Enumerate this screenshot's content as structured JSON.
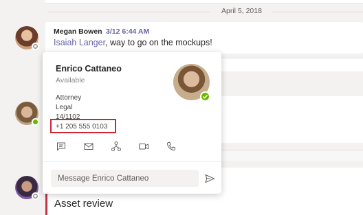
{
  "timeline": {
    "date": "April 5, 2018"
  },
  "message": {
    "author": "Megan Bowen",
    "time": "3/12 6:44 AM",
    "mention": "Isaiah Langer",
    "text": ", way to go on the mockups!"
  },
  "thread": {
    "title": "Asset review"
  },
  "profile_card": {
    "name": "Enrico Cattaneo",
    "status": "Available",
    "job_title": "Attorney",
    "department": "Legal",
    "office": "14/1102",
    "phone": "+1 205 555 0103",
    "presence_color": "#6bb700",
    "actions": [
      {
        "icon": "chat-icon"
      },
      {
        "icon": "mail-icon"
      },
      {
        "icon": "org-chart-icon"
      },
      {
        "icon": "video-call-icon"
      },
      {
        "icon": "phone-call-icon"
      }
    ],
    "message_placeholder": "Message Enrico Cattaneo",
    "highlight_color": "#d1242f"
  },
  "colors": {
    "accent": "#6264a7",
    "available": "#6bb700"
  }
}
